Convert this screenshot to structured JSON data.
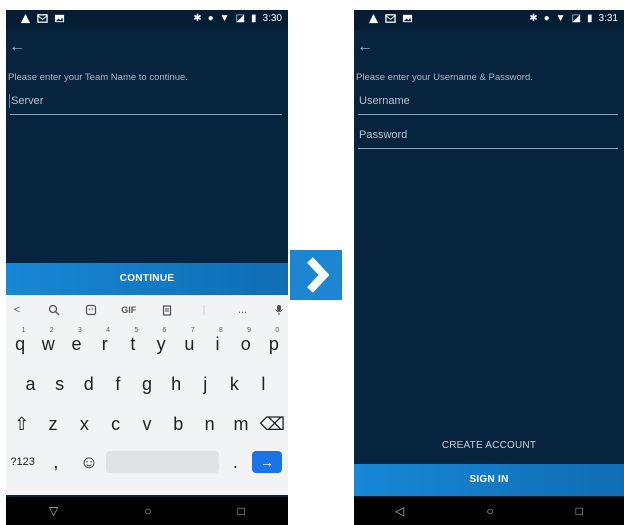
{
  "left_screen": {
    "status": {
      "time": "3:30"
    },
    "prompt": "Please enter your Team Name to continue.",
    "server_field": {
      "placeholder": "Server"
    },
    "continue_label": "CONTINUE",
    "keyboard": {
      "toolbar": [
        "<",
        "search-icon",
        "sticker-icon",
        "GIF",
        "clipboard-icon",
        "|",
        "...",
        "mic-icon"
      ],
      "row1": [
        {
          "k": "q",
          "n": "1"
        },
        {
          "k": "w",
          "n": "2"
        },
        {
          "k": "e",
          "n": "3"
        },
        {
          "k": "r",
          "n": "4"
        },
        {
          "k": "t",
          "n": "5"
        },
        {
          "k": "y",
          "n": "6"
        },
        {
          "k": "u",
          "n": "7"
        },
        {
          "k": "i",
          "n": "8"
        },
        {
          "k": "o",
          "n": "9"
        },
        {
          "k": "p",
          "n": "0"
        }
      ],
      "row2": [
        "a",
        "s",
        "d",
        "f",
        "g",
        "h",
        "j",
        "k",
        "l"
      ],
      "row3": [
        "⇧",
        "z",
        "x",
        "c",
        "v",
        "b",
        "n",
        "m",
        "⌫"
      ],
      "row4": {
        "symbols": "?123",
        "comma": ",",
        "emoji": "☺",
        "period": ".",
        "enter": "→"
      }
    },
    "nav": [
      "▽",
      "○",
      "□"
    ]
  },
  "transition_arrow": "›",
  "right_screen": {
    "status": {
      "time": "3:31"
    },
    "prompt": "Please enter your Username & Password.",
    "username_field": {
      "placeholder": "Username"
    },
    "password_field": {
      "placeholder": "Password"
    },
    "create_account_label": "CREATE ACCOUNT",
    "sign_in_label": "SIGN IN",
    "nav": [
      "◁",
      "○",
      "□"
    ]
  },
  "colors": {
    "screen_bg": "#07243f",
    "button": "#137cc9",
    "arrow_box": "#1e86d0"
  }
}
